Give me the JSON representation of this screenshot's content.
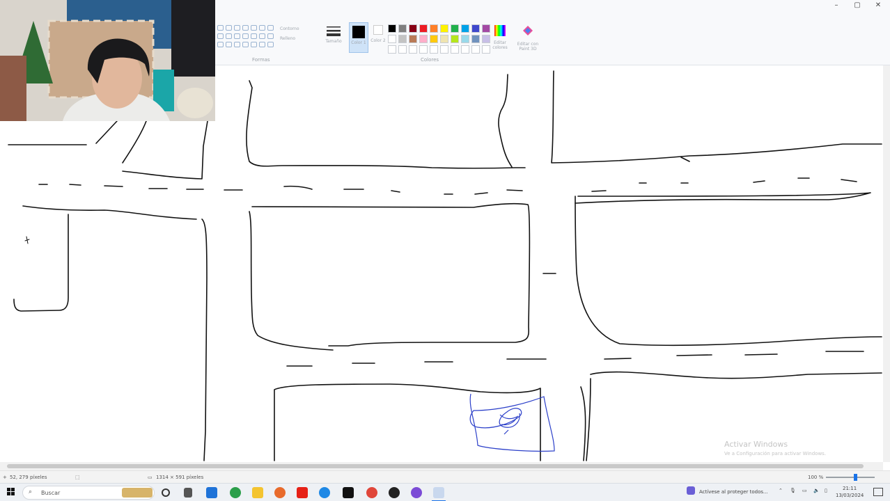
{
  "window": {
    "minimize_glyph": "–",
    "maximize_glyph": "▢",
    "close_glyph": "✕"
  },
  "ribbon": {
    "shapes_caption": "Formas",
    "colors_caption": "Colores",
    "outline_label": "Contorno",
    "fill_label": "Relleno",
    "size_label": "Tamaño",
    "color1_label": "Color 1",
    "color2_label": "Color 2",
    "edit_colors_label": "Editar colores",
    "paint3d_label": "Editar con Paint 3D",
    "palette": [
      "#000000",
      "#7f7f7f",
      "#880015",
      "#ed1c24",
      "#ff7f27",
      "#fff200",
      "#22b14c",
      "#00a2e8",
      "#3f48cc",
      "#a349a4",
      "#ffffff",
      "#c3c3c3",
      "#b97a57",
      "#ffaec9",
      "#ffc90e",
      "#efe4b0",
      "#b5e61d",
      "#99d9ea",
      "#7092be",
      "#c8bfe7",
      "#ffffff",
      "#ffffff",
      "#ffffff",
      "#ffffff",
      "#ffffff",
      "#ffffff",
      "#ffffff",
      "#ffffff",
      "#ffffff",
      "#ffffff"
    ]
  },
  "watermark": {
    "title": "Activar Windows",
    "subtitle": "Ve a Configuración para activar Windows."
  },
  "statusbar": {
    "cursor_pos": "52, 279 píxeles",
    "canvas_size": "1314 × 591 píxeles",
    "zoom": "100 %"
  },
  "taskbar": {
    "search_placeholder": "Buscar",
    "tray_notification": "Actívese al proteger todos...",
    "time": "21:11",
    "date": "13/03/2024"
  },
  "colors": {
    "stroke": "#111111",
    "scribble": "#2b3fc9"
  }
}
